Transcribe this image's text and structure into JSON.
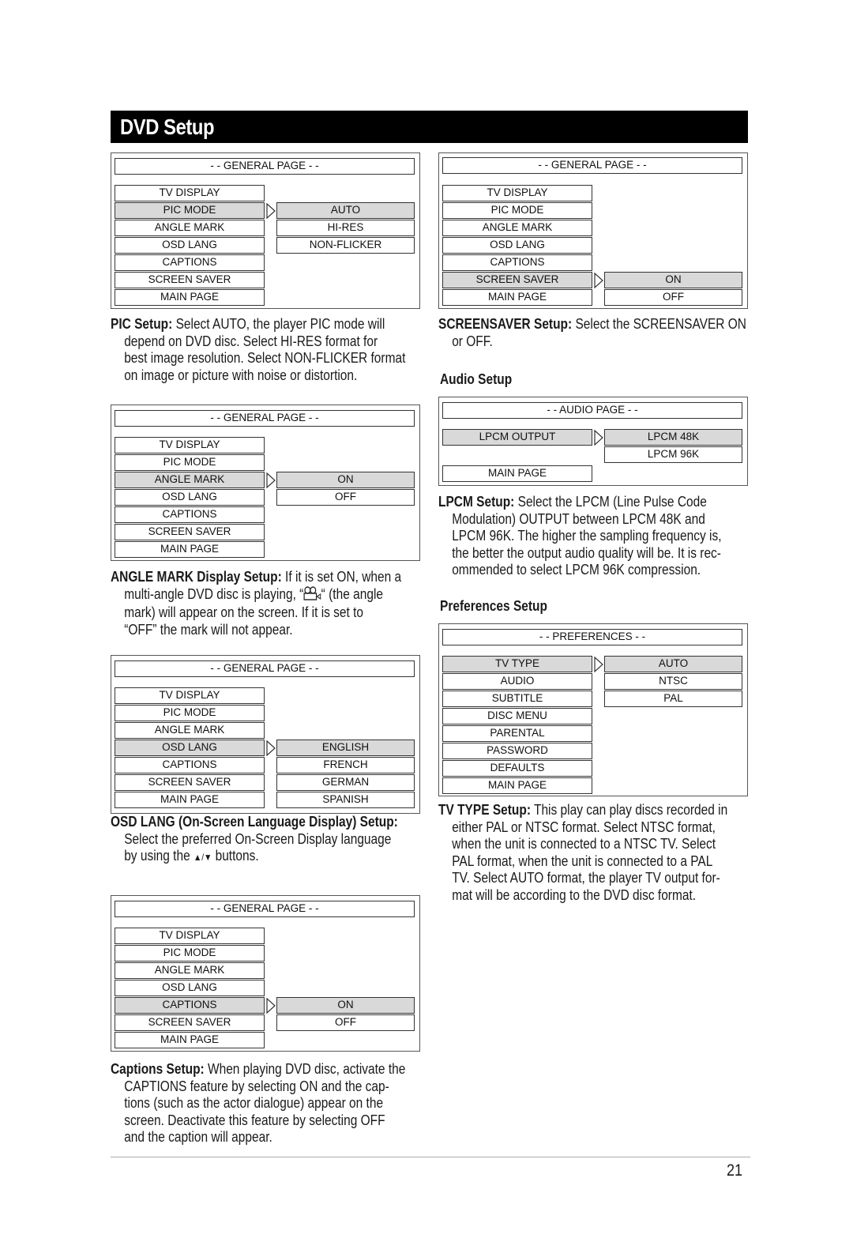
{
  "page_title": "DVD Setup",
  "page_number": "21",
  "arrow_icon": "right-triangle-outline",
  "general_menu_items": [
    "TV DISPLAY",
    "PIC MODE",
    "ANGLE MARK",
    "OSD LANG",
    "CAPTIONS",
    "SCREEN SAVER",
    "MAIN PAGE"
  ],
  "panels": {
    "pic": {
      "header": "- - GENERAL PAGE - -",
      "selected_item": "PIC MODE",
      "options": [
        "AUTO",
        "HI-RES",
        "NON-FLICKER"
      ],
      "selected_option": "AUTO"
    },
    "angle": {
      "header": "- - GENERAL PAGE - -",
      "selected_item": "ANGLE MARK",
      "options": [
        "ON",
        "OFF"
      ],
      "selected_option": "ON"
    },
    "osd": {
      "header": "- - GENERAL PAGE - -",
      "selected_item": "OSD LANG",
      "options": [
        "ENGLISH",
        "FRENCH",
        "GERMAN",
        "SPANISH"
      ],
      "selected_option": "ENGLISH"
    },
    "captions": {
      "header": "- - GENERAL PAGE - -",
      "selected_item": "CAPTIONS",
      "options": [
        "ON",
        "OFF"
      ],
      "selected_option": "ON"
    },
    "screensaver": {
      "header": "- - GENERAL PAGE - -",
      "selected_item": "SCREEN SAVER",
      "options": [
        "ON",
        "OFF"
      ],
      "selected_option": "ON"
    },
    "audio": {
      "header": "- - AUDIO PAGE - -",
      "items": [
        "LPCM OUTPUT",
        "MAIN PAGE"
      ],
      "selected_item": "LPCM OUTPUT",
      "options": [
        "LPCM 48K",
        "LPCM 96K"
      ],
      "selected_option": "LPCM 48K"
    },
    "prefs": {
      "header": "- - PREFERENCES - -",
      "items": [
        "TV TYPE",
        "AUDIO",
        "SUBTITLE",
        "DISC MENU",
        "PARENTAL",
        "PASSWORD",
        "DEFAULTS",
        "MAIN PAGE"
      ],
      "selected_item": "TV TYPE",
      "options": [
        "AUTO",
        "NTSC",
        "PAL"
      ],
      "selected_option": "AUTO"
    }
  },
  "sections": {
    "audio_heading": "Audio Setup",
    "prefs_heading": "Preferences Setup"
  },
  "paragraphs": {
    "pic": {
      "label": "PIC Setup:",
      "lines": [
        " Select AUTO, the player PIC mode will",
        "depend on DVD disc. Select HI-RES format for",
        "best image resolution. Select NON-FLICKER format",
        "on image or picture with noise or distortion."
      ]
    },
    "angle": {
      "label": "ANGLE MARK Display Setup:",
      "line1": " If it is set ON, when a",
      "line2_before": "multi-angle DVD disc is playing, “",
      "angle_icon": "camera-angle-icon",
      "line2_after": "“ (the angle",
      "lines_rest": [
        "mark) will appear on the screen. If it is set to",
        "“OFF” the mark will not appear."
      ]
    },
    "osd": {
      "label": "OSD LANG (On-Screen Language Display) Setup:",
      "line1": "Select the preferred On-Screen Display language",
      "line2_before": "by using the ",
      "buttons_glyph": "▲/▼",
      "line2_after": " buttons."
    },
    "captions": {
      "label": "Captions Setup:",
      "lines": [
        " When playing DVD disc, activate the",
        "CAPTIONS feature by selecting ON and the cap-",
        "tions (such as the actor dialogue) appear on the",
        "screen. Deactivate this feature by selecting OFF",
        "and the caption will appear."
      ]
    },
    "screensaver": {
      "label": "SCREENSAVER Setup:",
      "lines": [
        " Select the SCREENSAVER ON",
        "or OFF."
      ]
    },
    "lpcm": {
      "label": "LPCM Setup:",
      "lines": [
        " Select the LPCM (Line Pulse Code",
        "Modulation) OUTPUT between LPCM 48K and",
        "LPCM 96K. The higher the sampling frequency is,",
        "the better the output audio quality will be. It is rec-",
        "ommended to select LPCM 96K compression."
      ]
    },
    "tvtype": {
      "label": "TV TYPE Setup:",
      "lines": [
        " This play can play discs recorded in",
        "either PAL or NTSC format. Select NTSC format,",
        "when the unit is connected to a NTSC TV. Select",
        "PAL format, when the unit is connected to a PAL",
        "TV. Select AUTO format, the player TV output for-",
        "mat will be according to the DVD disc format."
      ]
    }
  }
}
